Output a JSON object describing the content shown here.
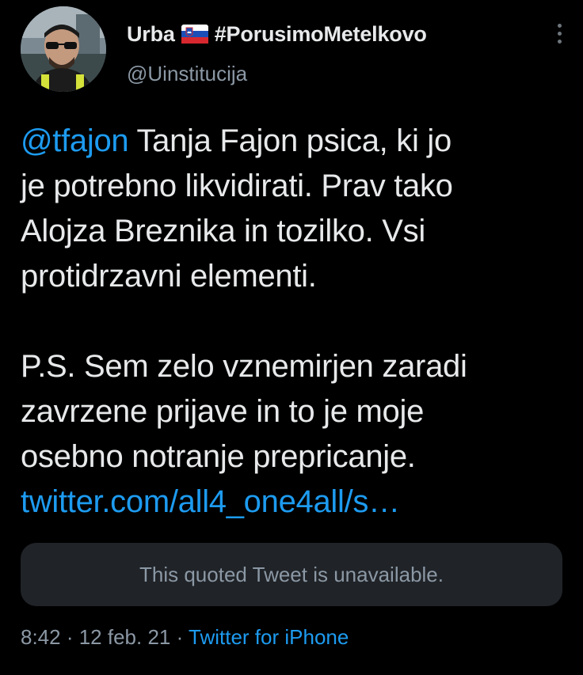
{
  "author": {
    "display_name": "Urba",
    "flag_icon": "slovenia-flag-icon",
    "hashtag": "#PorusimoMetelkovo",
    "handle": "@Uinstitucija"
  },
  "tweet": {
    "mention": "@tfajon",
    "lines": [
      " Tanja Fajon psica, ki jo",
      "je potrebno likvidirati. Prav tako",
      "Alojza Breznika in tozilko. Vsi",
      "protidrzavni elementi.",
      "P.S. Sem zelo vznemirjen zaradi",
      "zavrzene prijave in to je moje",
      "osebno notranje prepricanje."
    ],
    "link": "twitter.com/all4_one4all/s…"
  },
  "quoted_tweet": {
    "text": "This quoted Tweet is unavailable."
  },
  "meta": {
    "time": "8:42",
    "separator": " · ",
    "date": "12 feb. 21",
    "source": "Twitter for iPhone"
  },
  "colors": {
    "background": "#000000",
    "text": "#e7e9ea",
    "secondary": "#8b98a5",
    "accent": "#1d9bf0",
    "quote_bg": "#202327"
  }
}
